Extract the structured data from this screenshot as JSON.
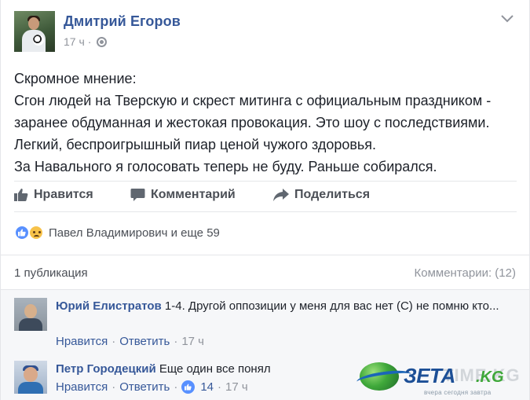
{
  "post": {
    "author": "Дмитрий Егоров",
    "time": "17 ч",
    "separator": "·",
    "text_lines": [
      "Скромное мнение:",
      "Сгон людей на Тверскую и скрест митинга с официальным праздником -",
      "заранее обдуманная и жестокая провокация. Это шоу с последствиями.",
      "Легкий, беспроигрышный пиар ценой чужого здоровья.",
      "За Навального я голосовать теперь не буду. Раньше собирался."
    ]
  },
  "actions": {
    "like": "Нравится",
    "comment": "Комментарий",
    "share": "Поделиться"
  },
  "reactions": {
    "summary": "Павел Владимирович и еще 59"
  },
  "stats": {
    "shares": "1 публикация",
    "comments": "Комментарии: (12)"
  },
  "comments": [
    {
      "name": "Юрий Елистратов",
      "text": "1-4. Другой оппозиции у меня для вас нет (С) не помню кто...",
      "like": "Нравится",
      "reply": "Ответить",
      "time": "17 ч"
    },
    {
      "name": "Петр Городецкий",
      "text": "Еще один все понял",
      "like": "Нравится",
      "reply": "Ответить",
      "likes_count": "14",
      "time": "17 ч"
    }
  ],
  "watermark": {
    "brand": "ЗЕТА",
    "domain": ".KG",
    "tagline": "вчера сегодня завтра",
    "ghost": "TIME.KG"
  },
  "colors": {
    "link": "#365899",
    "muted": "#90949c",
    "text": "#1d2129",
    "like_blue": "#5890ff"
  },
  "icons": [
    "thumbs-up-icon",
    "comment-icon",
    "share-icon",
    "globe-icon",
    "chevron-down-icon",
    "like-reaction-icon",
    "sad-reaction-icon"
  ]
}
